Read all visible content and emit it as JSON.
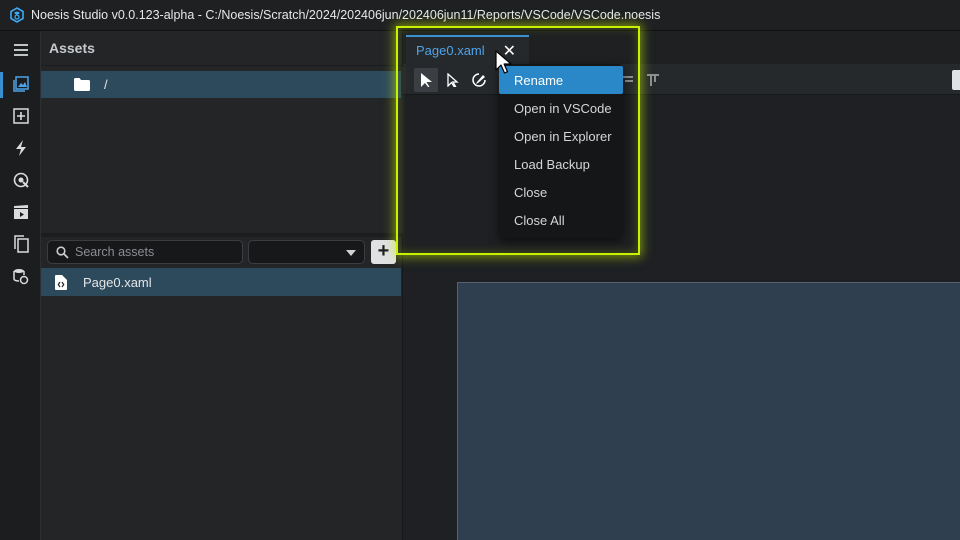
{
  "window": {
    "title": "Noesis Studio v0.0.123-alpha - C:/Noesis/Scratch/2024/202406jun/202406jun11/Reports/VSCode/VSCode.noesis",
    "logo_icon": "noesis-logo-icon"
  },
  "activity_bar": {
    "items": [
      {
        "icon": "menu-icon"
      },
      {
        "icon": "assets-icon",
        "active": true
      },
      {
        "icon": "add-box-icon"
      },
      {
        "icon": "lightning-icon"
      },
      {
        "icon": "target-icon"
      },
      {
        "icon": "clapper-icon"
      },
      {
        "icon": "documents-icon"
      },
      {
        "icon": "database-link-icon"
      }
    ]
  },
  "assets_panel": {
    "title": "Assets",
    "tree": [
      {
        "label": "/",
        "icon": "folder-icon"
      }
    ],
    "search": {
      "placeholder": "Search assets",
      "value": ""
    },
    "filter": {
      "value": ""
    },
    "add_label": "+",
    "files": [
      {
        "label": "Page0.xaml",
        "icon": "xaml-file-icon"
      }
    ]
  },
  "editor": {
    "tabs": [
      {
        "label": "Page0.xaml",
        "close": "✕"
      }
    ],
    "toolbar": [
      "select-icon",
      "direct-select-icon",
      "pen-icon",
      "align-left-icon",
      "align-top-icon"
    ]
  },
  "context_menu": {
    "items": [
      {
        "label": "Rename",
        "highlighted": true
      },
      {
        "label": "Open in VSCode"
      },
      {
        "label": "Open in Explorer"
      },
      {
        "label": "Load Backup"
      },
      {
        "label": "Close"
      },
      {
        "label": "Close All"
      }
    ]
  },
  "colors": {
    "accent": "#3a8fd1",
    "selection": "#2d4a5c",
    "menu_highlight": "#2a88c8",
    "callout": "#c8f000"
  }
}
